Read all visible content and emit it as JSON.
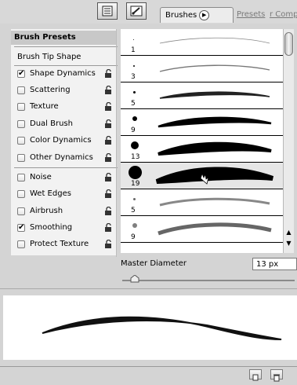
{
  "tabs": [
    {
      "label": "Brushes",
      "active": true
    },
    {
      "label": "Presets",
      "active": false
    },
    {
      "label": "r Comps",
      "active": false
    }
  ],
  "left_panel": {
    "presets_label": "Brush Presets",
    "tip_shape_label": "Brush Tip Shape",
    "options": [
      {
        "label": "Shape Dynamics",
        "checked": true
      },
      {
        "label": "Scattering",
        "checked": false
      },
      {
        "label": "Texture",
        "checked": false
      },
      {
        "label": "Dual Brush",
        "checked": false
      },
      {
        "label": "Color Dynamics",
        "checked": false
      },
      {
        "label": "Other Dynamics",
        "checked": false
      },
      {
        "label": "Noise",
        "checked": false
      },
      {
        "label": "Wet Edges",
        "checked": false
      },
      {
        "label": "Airbrush",
        "checked": false
      },
      {
        "label": "Smoothing",
        "checked": true
      },
      {
        "label": "Protect Texture",
        "checked": false
      }
    ]
  },
  "brushes": [
    {
      "size": "1"
    },
    {
      "size": "3"
    },
    {
      "size": "5"
    },
    {
      "size": "9"
    },
    {
      "size": "13"
    },
    {
      "size": "19",
      "selected": true
    },
    {
      "size": "5"
    },
    {
      "size": "9"
    }
  ],
  "master_diameter": {
    "label": "Master Diameter",
    "value": "13 px"
  },
  "icons": {
    "palette_menu": "palette-menu-icon",
    "brush_palette": "brush-palette-icon",
    "lock": "lock-icon",
    "new_brush": "new-brush-icon",
    "trash": "trash-icon"
  }
}
